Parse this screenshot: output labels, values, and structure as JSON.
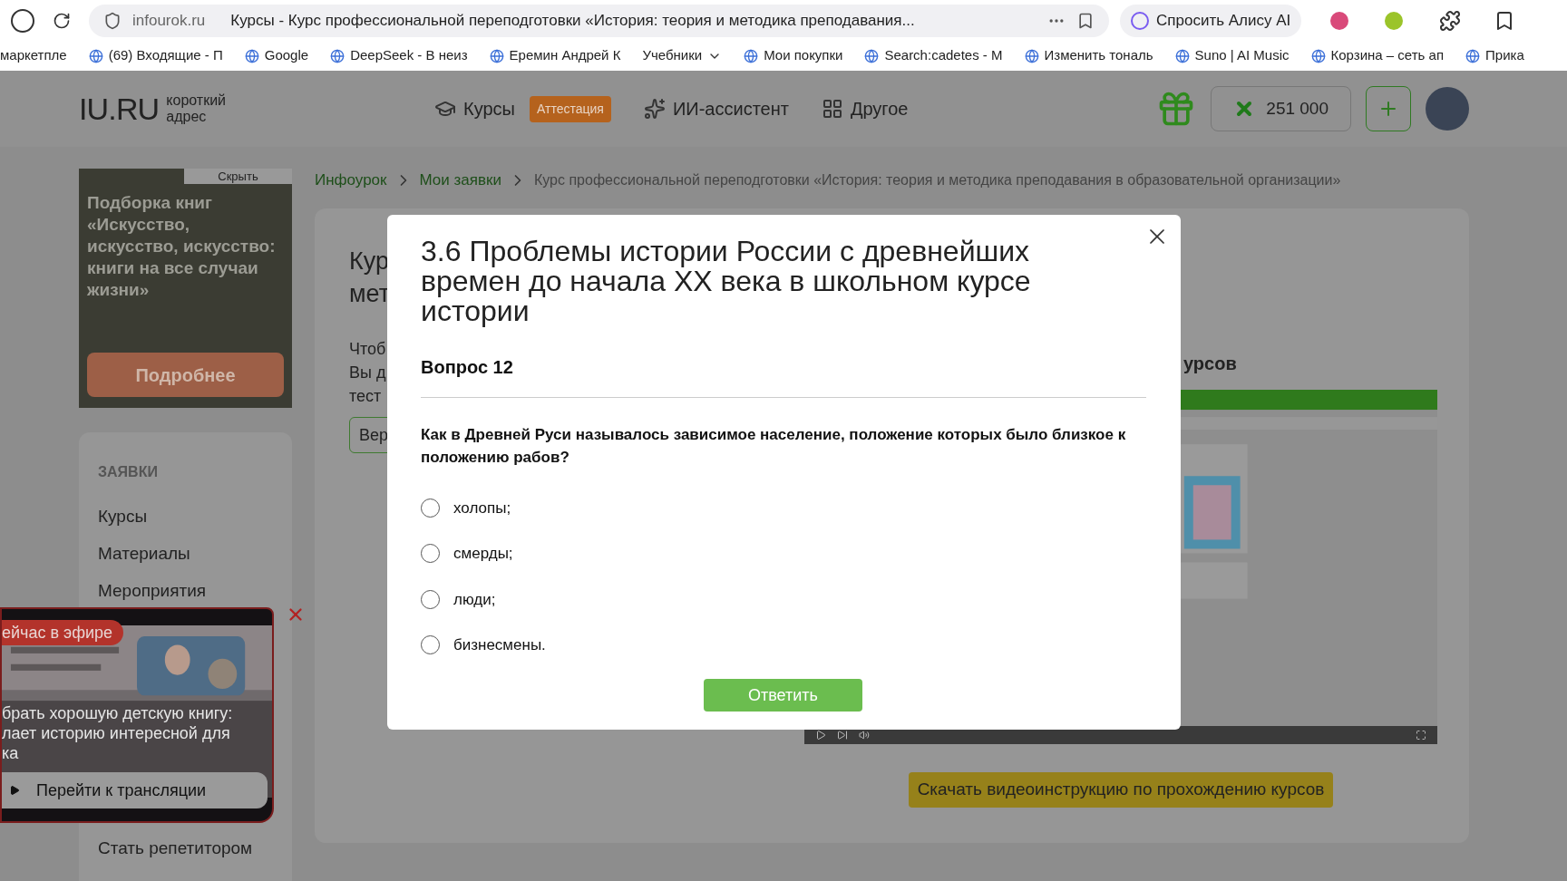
{
  "browser": {
    "address": "infourok.ru",
    "tab_title": "Курсы - Курс профессиональной переподготовки «История: теория и методика преподавания...",
    "alice": "Спросить Алису AI"
  },
  "bookmarks": [
    {
      "label": "маркетпле",
      "kind": "cut"
    },
    {
      "label": "(69) Входящие - П",
      "kind": "link"
    },
    {
      "label": "Google",
      "kind": "link"
    },
    {
      "label": "DeepSeek - В неиз",
      "kind": "link"
    },
    {
      "label": "Еремин Андрей К",
      "kind": "link"
    },
    {
      "label": "Учебники",
      "kind": "folder"
    },
    {
      "label": "Мои покупки",
      "kind": "link"
    },
    {
      "label": "Search:cadetes - М",
      "kind": "link"
    },
    {
      "label": "Изменить тональ",
      "kind": "link"
    },
    {
      "label": "Suno | AI Music",
      "kind": "link"
    },
    {
      "label": "Корзина – сеть ап",
      "kind": "link"
    },
    {
      "label": "Прика",
      "kind": "link"
    }
  ],
  "header": {
    "logo": "IU.RU",
    "logo_caption": [
      "короткий",
      "адрес"
    ],
    "nav": [
      {
        "label": "Курсы",
        "badge": "Аттестация"
      },
      {
        "label": "ИИ-ассистент"
      },
      {
        "label": "Другое"
      }
    ],
    "balance": "251 000"
  },
  "ad": {
    "hide": "Скрыть",
    "title": "Подборка книг «Искусство, искусство, искусство: книги на все случаи жизни»",
    "button": "Подробнее"
  },
  "menu": {
    "heading": "ЗАЯВКИ",
    "items": [
      "Курсы",
      "Материалы",
      "Мероприятия"
    ],
    "last_item": "Стать репетитором"
  },
  "breadcrumbs": [
    {
      "label": "Инфоурок",
      "kind": "link"
    },
    {
      "label": "Мои заявки",
      "kind": "link"
    },
    {
      "label": "Курс профессиональной переподготовки «История: теория и методика преподавания в образовательной организации»",
      "kind": "current"
    }
  ],
  "main": {
    "title_lines": [
      "Кур",
      "мет"
    ],
    "text_lines": [
      "Чтоб",
      "Вы д",
      "тест"
    ],
    "button": "Вер",
    "video_heading": "урсов",
    "download": "Скачать видеоинструкцию по прохождению курсов"
  },
  "live": {
    "badge": "ейчас в эфире",
    "caption_lines": [
      "брать хорошую детскую книгу:",
      "лает историю интересной для",
      "ка"
    ],
    "button": "Перейти к трансляции"
  },
  "modal": {
    "title": "3.6 Проблемы истории России с древнейших времен до начала XX века в школьном курсе истории",
    "question_label": "Вопрос 12",
    "question": "Как в Древней Руси называлось зависимое население, положение которых было близкое к положению рабов?",
    "options": [
      {
        "label": "холопы;",
        "selected": false
      },
      {
        "label": "смерды;",
        "selected": false
      },
      {
        "label": "люди;",
        "selected": false
      },
      {
        "label": "бизнесмены.",
        "selected": false
      }
    ],
    "submit": "Ответить"
  }
}
